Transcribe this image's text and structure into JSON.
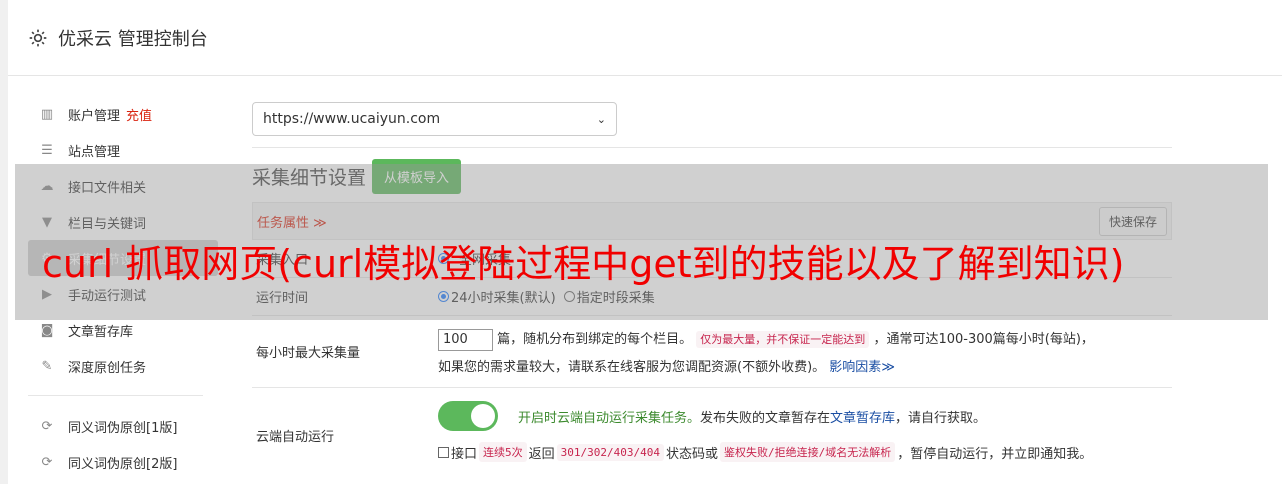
{
  "header": {
    "title": "优采云 管理控制台"
  },
  "sidebar": {
    "items": [
      {
        "label": "账户管理",
        "extra": "充值",
        "icon": "bar-chart-icon"
      },
      {
        "label": "站点管理",
        "icon": "server-icon"
      },
      {
        "label": "接口文件相关",
        "icon": "cloud-upload-icon"
      },
      {
        "label": "栏目与关键词",
        "icon": "filter-icon"
      },
      {
        "label": "采集细节设置",
        "icon": "cogs-icon",
        "active": true
      },
      {
        "label": "手动运行测试",
        "icon": "play-circle-icon"
      },
      {
        "label": "文章暂存库",
        "icon": "database-icon"
      },
      {
        "label": "深度原创任务",
        "icon": "edit-icon"
      }
    ],
    "items2": [
      {
        "label": "同义词伪原创[1版]",
        "icon": "refresh-icon"
      },
      {
        "label": "同义词伪原创[2版]",
        "icon": "refresh-icon"
      }
    ]
  },
  "main": {
    "url_select": "https://www.ucaiyun.com",
    "section_title": "采集细节设置",
    "import_button": "从模板导入",
    "task_attr": "任务属性 ≫",
    "quick_save": "快速保存",
    "row1_label": "采集入口",
    "row1_value": "全网采集",
    "row2_label": "运行时间",
    "row2_opt1": "24小时采集(默认)",
    "row2_opt2": "指定时段采集",
    "row3_label": "每小时最大采集量",
    "row3_input": "100",
    "row3_text1": "篇，随机分布到绑定的每个栏目。",
    "row3_code": "仅为最大量，并不保证一定能达到",
    "row3_text2": "，通常可达100-300篇每小时(每站)，",
    "row3_text3": "如果您的需求量较大，请联系在线客服为您调配资源(不额外收费)。",
    "row3_link": "影响因素",
    "row4_label": "云端自动运行",
    "row4_green": "开启时云端自动运行采集任务。",
    "row4_text1": "发布失败的文章暂存在",
    "row4_link": "文章暂存库",
    "row4_text2": "，请自行获取。",
    "row4_check_text1": "接口",
    "row4_code1": "连续5次",
    "row4_check_text2": "返回",
    "row4_code2": "301/302/403/404",
    "row4_check_text3": "状态码或",
    "row4_code3": "鉴权失败/拒绝连接/域名无法解析",
    "row4_check_text4": "，暂停自动运行，并立即通知我。"
  },
  "overlay": {
    "title": "curl 抓取网页(curl模拟登陆过程中get到的技能以及了解到知识)"
  },
  "colors": {
    "accent_green": "#5cb85c",
    "link_blue": "#1a4ea3",
    "code_red": "#c7254e",
    "title_red": "#f10000"
  }
}
